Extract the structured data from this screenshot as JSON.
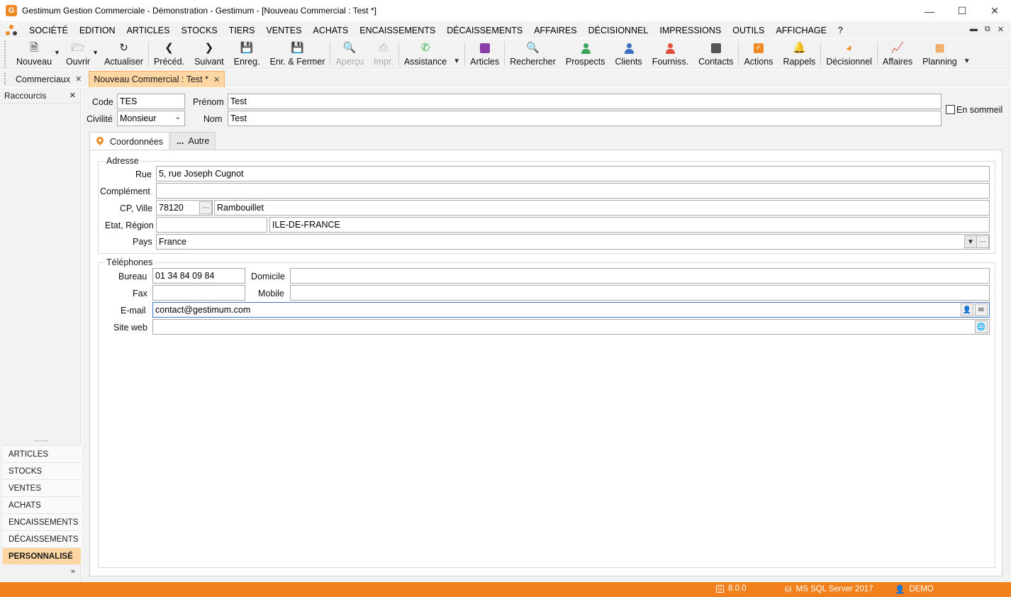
{
  "window": {
    "title": "Gestimum Gestion Commerciale - Démonstration - Gestimum - [Nouveau Commercial : Test *]",
    "logo_letter": "G"
  },
  "menu": [
    "SOCIÉTÉ",
    "EDITION",
    "ARTICLES",
    "STOCKS",
    "TIERS",
    "VENTES",
    "ACHATS",
    "ENCAISSEMENTS",
    "DÉCAISSEMENTS",
    "AFFAIRES",
    "DÉCISIONNEL",
    "IMPRESSIONS",
    "OUTILS",
    "AFFICHAGE",
    "?"
  ],
  "toolbar": {
    "nouveau": "Nouveau",
    "ouvrir": "Ouvrir",
    "actualiser": "Actualiser",
    "preced": "Précéd.",
    "suivant": "Suivant",
    "enreg": "Enreg.",
    "enr_fermer": "Enr. & Fermer",
    "apercu": "Aperçu",
    "impr": "Impr.",
    "assistance": "Assistance",
    "articles": "Articles",
    "rechercher": "Rechercher",
    "prospects": "Prospects",
    "clients": "Clients",
    "fourniss": "Fourniss.",
    "contacts": "Contacts",
    "actions": "Actions",
    "rappels": "Rappels",
    "decisionnel": "Décisionnel",
    "affaires": "Affaires",
    "planning": "Planning"
  },
  "doc_tabs": {
    "commerciaux": "Commerciaux",
    "nouveau": "Nouveau Commercial : Test *"
  },
  "sidebar": {
    "title": "Raccourcis",
    "items": [
      "ARTICLES",
      "STOCKS",
      "VENTES",
      "ACHATS",
      "ENCAISSEMENTS",
      "DÉCAISSEMENTS",
      "PERSONNALISÉ"
    ]
  },
  "form": {
    "code_label": "Code",
    "code_value": "TES",
    "prenom_label": "Prénom",
    "prenom_value": "Test",
    "civilite_label": "Civilité",
    "civilite_value": "Monsieur",
    "nom_label": "Nom",
    "nom_value": "Test",
    "sommeil_label": "En sommeil"
  },
  "form_tabs": {
    "coordonnees": "Coordonnées",
    "autre": "Autre",
    "autre_dots": "..."
  },
  "adresse": {
    "title": "Adresse",
    "rue_label": "Rue",
    "rue_value": "5, rue Joseph Cugnot",
    "complement_label": "Complément",
    "complement_value": "",
    "cpville_label": "CP, Ville",
    "cp_value": "78120",
    "ville_value": "Rambouillet",
    "etat_label": "Etat, Région",
    "etat_value": "",
    "region_value": "ILE-DE-FRANCE",
    "pays_label": "Pays",
    "pays_value": "France"
  },
  "telephones": {
    "title": "Téléphones",
    "bureau_label": "Bureau",
    "bureau_value": "01 34 84 09 84",
    "domicile_label": "Domicile",
    "domicile_value": "",
    "fax_label": "Fax",
    "fax_value": "",
    "mobile_label": "Mobile",
    "mobile_value": "",
    "email_label": "E-mail",
    "email_value": "contact@gestimum.com",
    "siteweb_label": "Site web",
    "siteweb_value": ""
  },
  "status": {
    "version": "8.0.0",
    "server": "MS SQL Server 2017",
    "user": "DEMO"
  },
  "colors": {
    "accent": "#f2811d",
    "active_tab": "#fdd6a3"
  }
}
